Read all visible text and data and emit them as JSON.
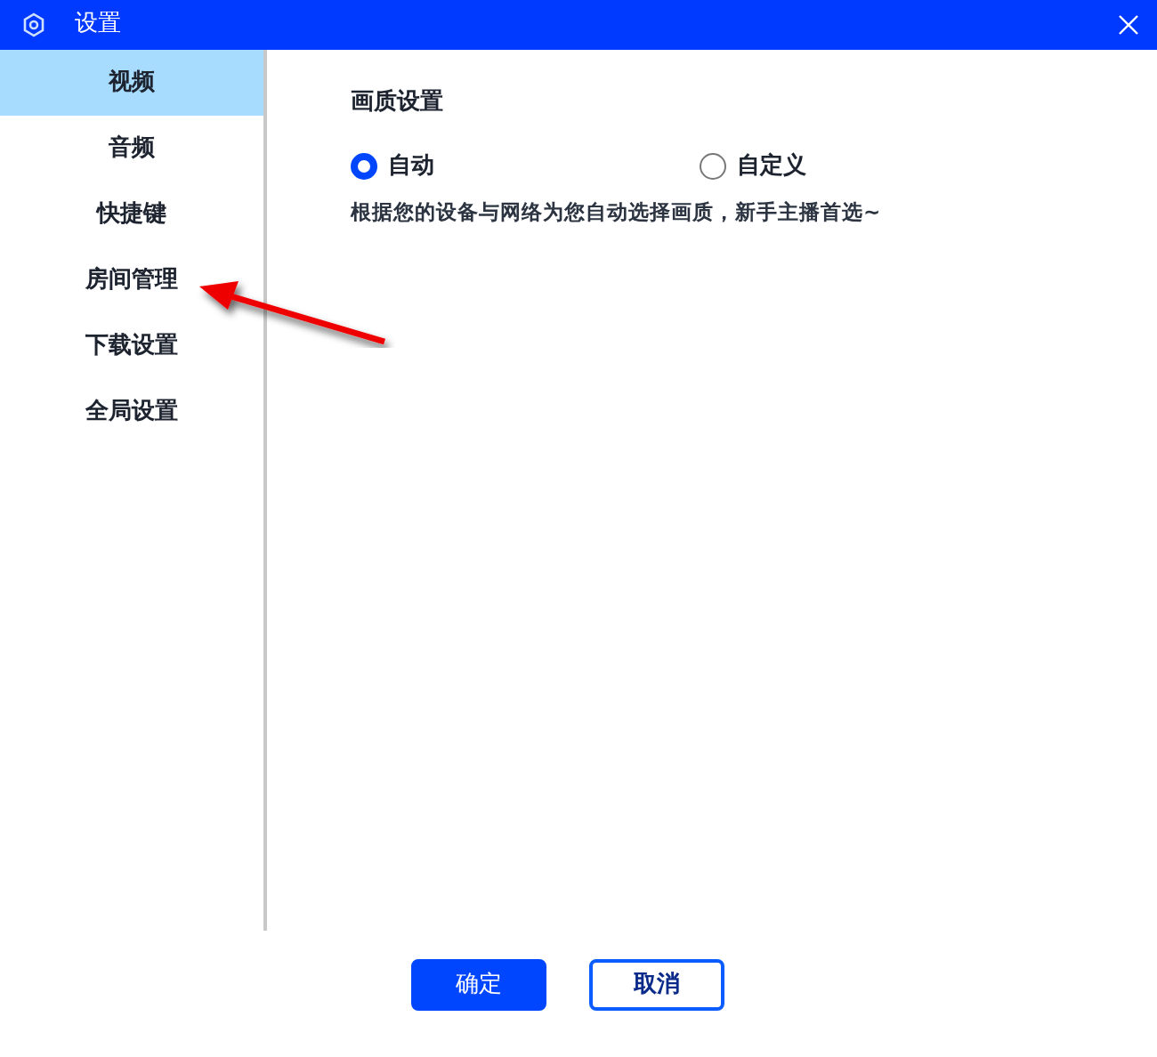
{
  "window": {
    "title": "设置"
  },
  "sidebar": {
    "items": [
      {
        "label": "视频",
        "selected": true
      },
      {
        "label": "音频",
        "selected": false
      },
      {
        "label": "快捷键",
        "selected": false
      },
      {
        "label": "房间管理",
        "selected": false
      },
      {
        "label": "下载设置",
        "selected": false
      },
      {
        "label": "全局设置",
        "selected": false
      }
    ]
  },
  "quality": {
    "heading": "画质设置",
    "options": [
      {
        "label": "自动",
        "selected": true
      },
      {
        "label": "自定义",
        "selected": false
      }
    ],
    "hint": "根据您的设备与网络为您自动选择画质，新手主播首选~"
  },
  "buttons": [
    {
      "label": "确定",
      "kind": "primary"
    },
    {
      "label": "取消",
      "kind": "secondary"
    }
  ]
}
